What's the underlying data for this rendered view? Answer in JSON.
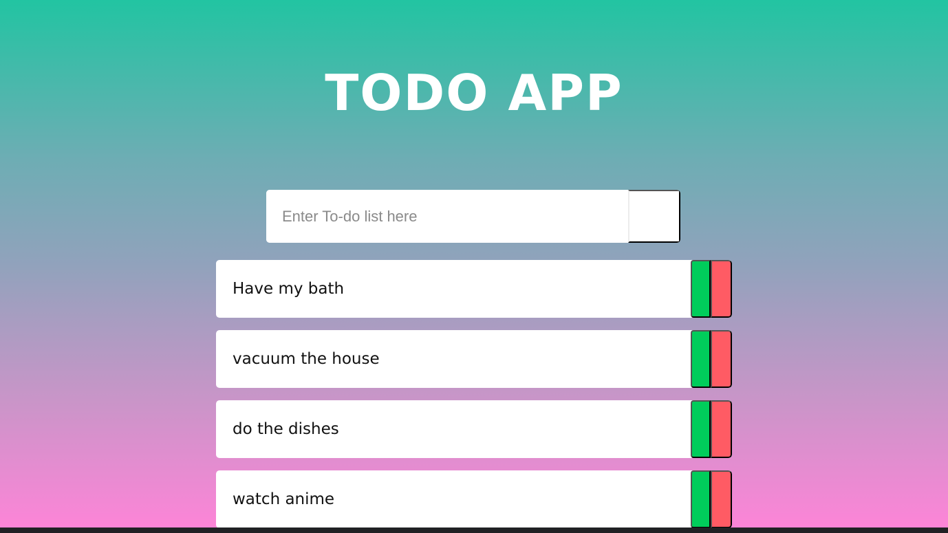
{
  "app": {
    "title": "TODO APP"
  },
  "form": {
    "placeholder": "Enter To-do list here",
    "value": ""
  },
  "todos": [
    {
      "text": "Have my bath"
    },
    {
      "text": "vacuum the house"
    },
    {
      "text": "do the dishes"
    },
    {
      "text": "watch anime"
    }
  ],
  "colors": {
    "gradient_top": "#22c4a2",
    "gradient_bottom": "#ff84d8",
    "complete": "#00cd5b",
    "delete": "#ff5b64"
  }
}
